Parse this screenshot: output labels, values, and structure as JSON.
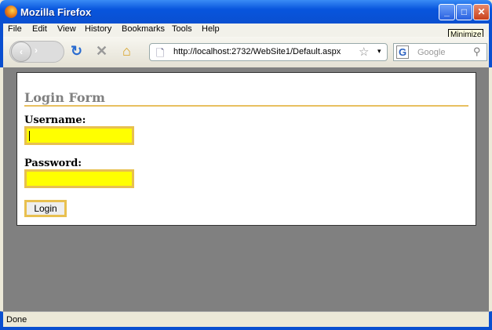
{
  "window": {
    "title": "Mozilla Firefox",
    "tooltip": "Minimize"
  },
  "menu": [
    "File",
    "Edit",
    "View",
    "History",
    "Bookmarks",
    "Tools",
    "Help"
  ],
  "toolbar": {
    "url": "http://localhost:2732/WebSite1/Default.aspx",
    "search_placeholder": "Google"
  },
  "form": {
    "title": "Login Form",
    "username_label": "Username:",
    "username_value": "",
    "password_label": "Password:",
    "password_value": "",
    "login_label": "Login"
  },
  "status": {
    "text": "Done"
  },
  "colors": {
    "input_bg": "#ffff00",
    "accent": "#e8c050",
    "page_bg": "#808080"
  }
}
